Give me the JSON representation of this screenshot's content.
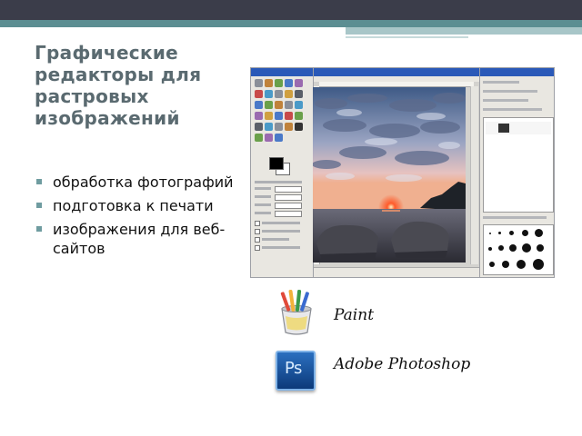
{
  "slide": {
    "title": "Графические редакторы для растровых изображений",
    "bullets": [
      "обработка фотографий",
      "подготовка к печати",
      "изображения для веб-сайтов"
    ]
  },
  "apps": {
    "paint": "Paint",
    "photoshop": "Adobe Photoshop",
    "photoshop_icon_text": "Ps"
  },
  "colors": {
    "top_bar": "#3b3d4a",
    "accent_teal": "#5c8e92",
    "title_text": "#5a6a70",
    "bullet_marker": "#6f9ca0"
  },
  "icons": [
    "paint-app-icon",
    "photoshop-app-icon"
  ]
}
